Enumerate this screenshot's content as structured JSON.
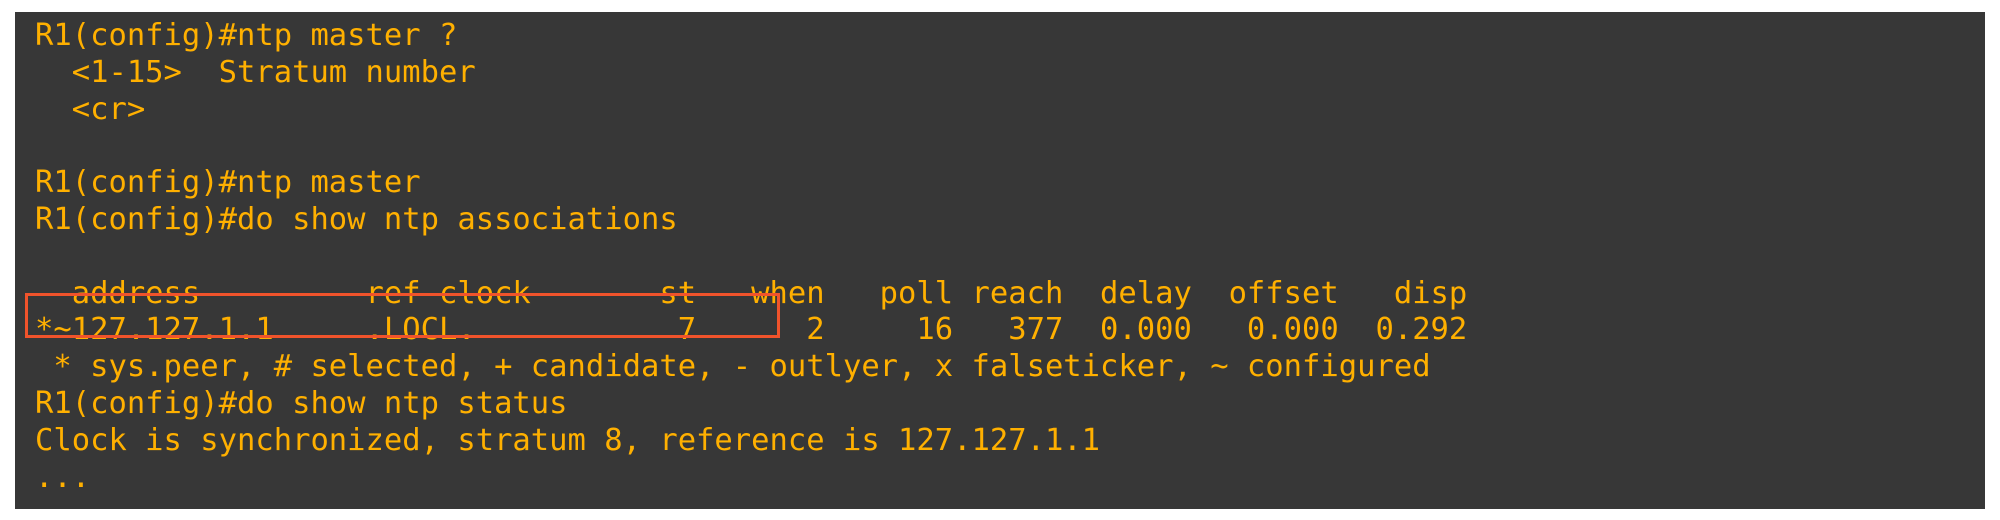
{
  "terminal": {
    "lines": [
      "R1(config)#ntp master ?",
      "  <1-15>  Stratum number",
      "  <cr>",
      "",
      "R1(config)#ntp master",
      "R1(config)#do show ntp associations",
      "",
      "  address         ref clock       st   when   poll reach  delay  offset   disp",
      "*~127.127.1.1     .LOCL.           7      2     16   377  0.000   0.000  0.292",
      " * sys.peer, # selected, + candidate, - outlyer, x falseticker, ~ configured",
      "R1(config)#do show ntp status",
      "Clock is synchronized, stratum 8, reference is 127.127.1.1",
      "..."
    ]
  },
  "colors": {
    "background": "#373737",
    "text": "#ffb000",
    "highlight_border": "#f0532b"
  }
}
